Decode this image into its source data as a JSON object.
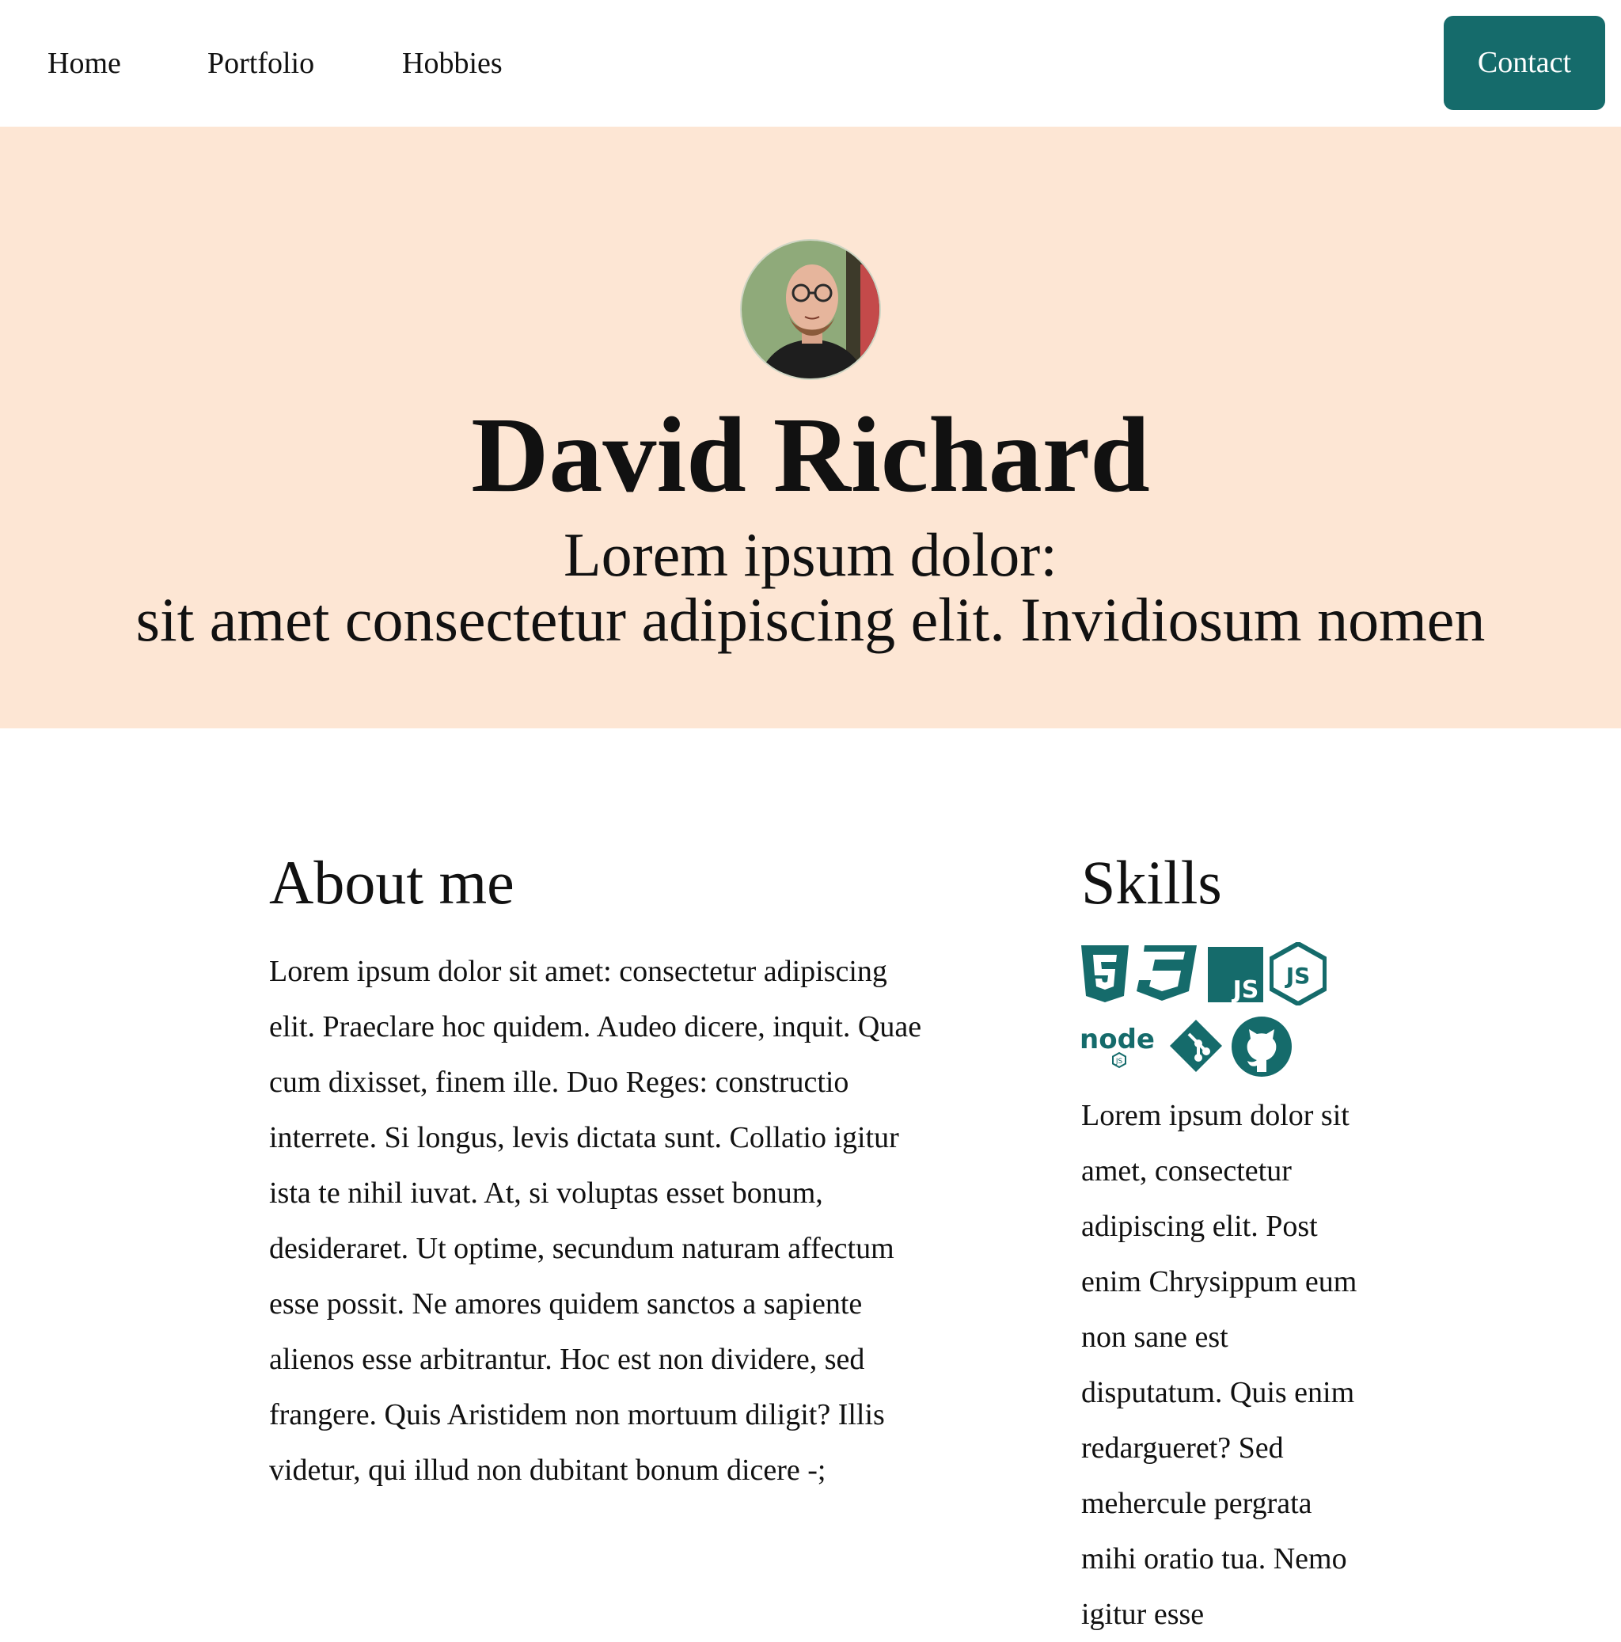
{
  "nav": {
    "items": [
      {
        "label": "Home"
      },
      {
        "label": "Portfolio"
      },
      {
        "label": "Hobbies"
      }
    ],
    "contact_label": "Contact"
  },
  "colors": {
    "accent": "#156b6b",
    "hero_background": "#fde6d4"
  },
  "hero": {
    "name": "David Richard",
    "subtitle_line1": "Lorem ipsum dolor:",
    "subtitle_line2": "sit amet consectetur adipiscing elit. Invidiosum nomen",
    "avatar_alt": "profile-photo"
  },
  "about": {
    "title": "About me",
    "text": "Lorem ipsum dolor sit amet: consectetur adipiscing elit. Praeclare hoc quidem. Audeo dicere, inquit. Quae cum dixisset, finem ille. Duo Reges: constructio interrete. Si longus, levis dictata sunt. Collatio igitur ista te nihil iuvat. At, si voluptas esset bonum, desideraret. Ut optime, secundum naturam affectum esse possit. Ne amores quidem sanctos a sapiente alienos esse arbitrantur. Hoc est non dividere, sed frangere. Quis Aristidem non mortuum diligit? Illis videtur, qui illud non dubitant bonum dicere -;"
  },
  "skills": {
    "title": "Skills",
    "icons": [
      "html5-icon",
      "css3-icon",
      "javascript-square-icon",
      "javascript-hex-icon",
      "nodejs-icon",
      "git-icon",
      "github-icon"
    ],
    "text": "Lorem ipsum dolor sit amet, consectetur adipiscing elit. Post enim Chrysippum eum non sane est disputatum. Quis enim redargueret? Sed mehercule pergrata mihi oratio tua. Nemo igitur esse"
  }
}
